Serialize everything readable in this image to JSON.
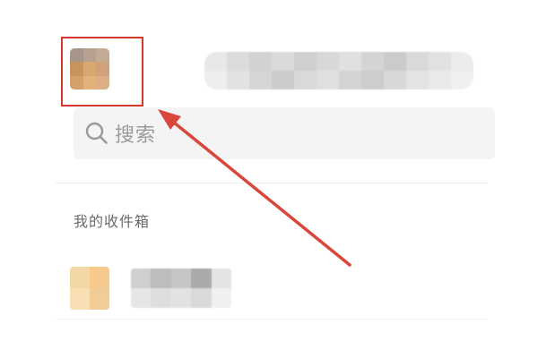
{
  "search": {
    "placeholder": "搜索",
    "icon": "search-icon"
  },
  "section": {
    "label": "我的收件箱"
  },
  "colors": {
    "highlight": "#d23a2e",
    "arrow": "#d9473c",
    "search_bg": "#f4f4f4",
    "label_text": "#6a6a6a",
    "placeholder_text": "#9a9a9a"
  },
  "avatar_mosaic": [
    "#a8958a",
    "#b6a090",
    "#c4ab95",
    "#c9935f",
    "#d8a871",
    "#cfa17c",
    "#d6a069",
    "#e2b27a",
    "#dcae84"
  ],
  "name_mosaic": [
    "#e8e8e8",
    "#dcdcdc",
    "#d2d2d2",
    "#dadada",
    "#cfcfcf",
    "#d8d8d8",
    "#e0e0e0",
    "#d4d4d4",
    "#cbcbcb",
    "#d9d9d9",
    "#e1e1e1",
    "#ececec",
    "#eeeeee",
    "#e2e2e2",
    "#d6d6d6",
    "#cccccc",
    "#d9d9d9",
    "#dfdfdf",
    "#d3d3d3",
    "#cdcdcd",
    "#d8d8d8",
    "#e3e3e3",
    "#e9e9e9",
    "#f0f0f0"
  ],
  "fav_icon_mosaic": [
    "#f3d7a6",
    "#f6c98d",
    "#f8dfb4",
    "#f1cc96"
  ],
  "fav_name_mosaic": [
    "#cfcfcf",
    "#bdbdbd",
    "#c6c6c6",
    "#aaaaaa",
    "#e4e4e4",
    "#e6e6e6",
    "#dedede",
    "#e2e2e2",
    "#d9d9d9",
    "#f0f0f0"
  ]
}
